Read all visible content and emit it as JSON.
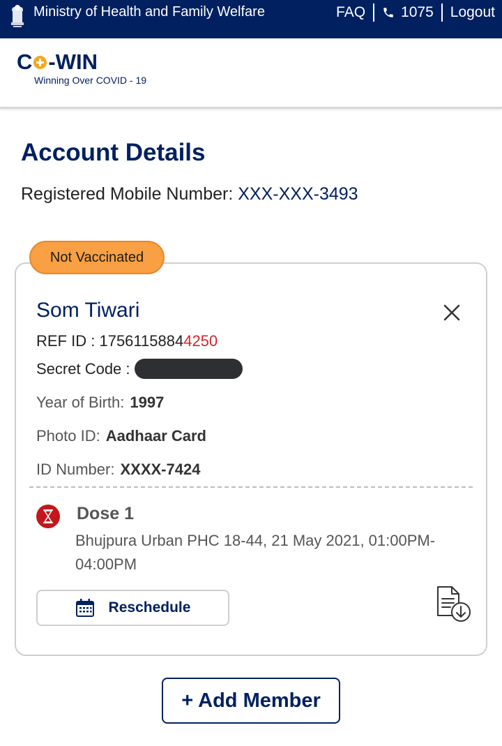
{
  "header": {
    "ministry": "Ministry of Health and Family Welfare",
    "faq": "FAQ",
    "phone": "1075",
    "logout": "Logout"
  },
  "brand": {
    "logo_left": "C",
    "logo_right": "-WIN",
    "tagline": "Winning Over COVID - 19"
  },
  "account": {
    "title": "Account Details",
    "mobile_label": "Registered Mobile Number:",
    "mobile_value": "XXX-XXX-3493"
  },
  "member": {
    "status": "Not Vaccinated",
    "name": "Som Tiwari",
    "ref_label": "REF ID :",
    "ref_main": "1756115884",
    "ref_last": "4250",
    "secret_label": "Secret Code :",
    "birth_label": "Year of Birth:",
    "birth_value": "1997",
    "photo_label": "Photo ID:",
    "photo_value": "Aadhaar Card",
    "idnum_label": "ID Number:",
    "idnum_value": "XXXX-7424",
    "dose_title": "Dose 1",
    "dose_slot": "Bhujpura Urban PHC 18-44, 21 May 2021, 01:00PM-04:00PM",
    "reschedule": "Reschedule"
  },
  "actions": {
    "add_member": "+ Add Member"
  },
  "colors": {
    "navy": "#002060",
    "badge_orange": "#f8a043",
    "alert_red": "#c4161c"
  }
}
